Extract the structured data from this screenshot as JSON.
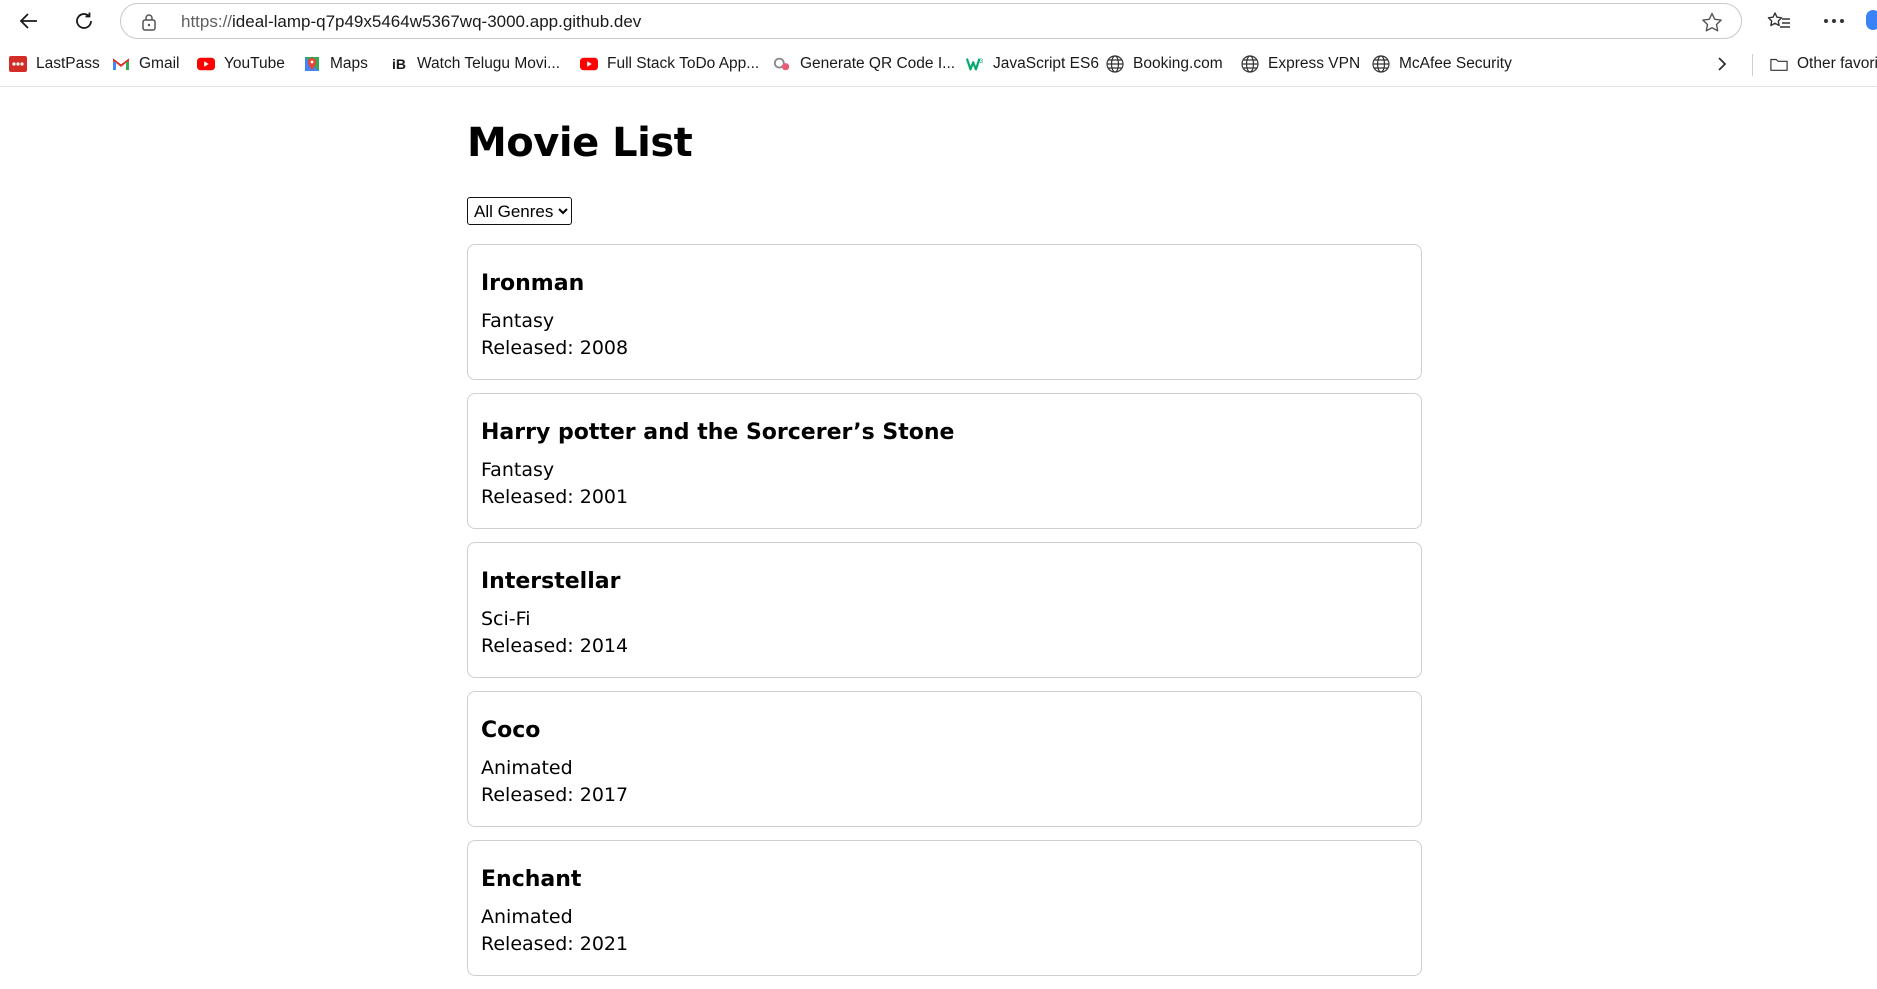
{
  "browser": {
    "url_protocol": "https://",
    "url_host": "ideal-lamp-q7p49x5464w5367wq-3000.app.github.dev",
    "bookmarks": [
      {
        "label": "LastPass",
        "icon": "lastpass-icon"
      },
      {
        "label": "Gmail",
        "icon": "gmail-icon"
      },
      {
        "label": "YouTube",
        "icon": "youtube-icon"
      },
      {
        "label": "Maps",
        "icon": "maps-icon"
      },
      {
        "label": "Watch Telugu Movi...",
        "icon": "ib-icon"
      },
      {
        "label": "Full Stack ToDo App...",
        "icon": "youtube-icon"
      },
      {
        "label": "Generate QR Code I...",
        "icon": "qr-icon"
      },
      {
        "label": "JavaScript ES6",
        "icon": "w3-icon"
      },
      {
        "label": "Booking.com",
        "icon": "globe-icon"
      },
      {
        "label": "Express VPN",
        "icon": "globe-icon"
      },
      {
        "label": "McAfee Security",
        "icon": "globe-icon"
      }
    ],
    "other_favorites": "Other favori"
  },
  "page": {
    "title": "Movie List",
    "genre_filter": {
      "selected": "All Genres"
    }
  },
  "movies": [
    {
      "title": "Ironman",
      "genre": "Fantasy",
      "released": "Released: 2008"
    },
    {
      "title": "Harry potter and the Sorcerer’s Stone",
      "genre": "Fantasy",
      "released": "Released: 2001"
    },
    {
      "title": "Interstellar",
      "genre": "Sci-Fi",
      "released": "Released: 2014"
    },
    {
      "title": "Coco",
      "genre": "Animated",
      "released": "Released: 2017"
    },
    {
      "title": "Enchant",
      "genre": "Animated",
      "released": "Released: 2021"
    }
  ],
  "colors": {
    "youtube": "#ff0000",
    "lastpass": "#d32d27",
    "maps_green": "#34a853"
  }
}
